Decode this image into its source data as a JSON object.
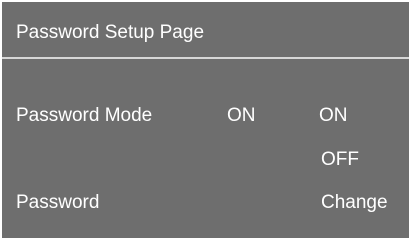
{
  "page": {
    "title": "Password Setup Page"
  },
  "password_mode": {
    "label": "Password Mode",
    "current_value": "ON",
    "options": [
      "ON",
      "OFF"
    ]
  },
  "password": {
    "label": "Password",
    "action": "Change"
  },
  "colors": {
    "panel_background": "#6e6e6e",
    "text": "#ffffff",
    "divider": "#d7d7d7",
    "page_background": "#ffffff"
  }
}
